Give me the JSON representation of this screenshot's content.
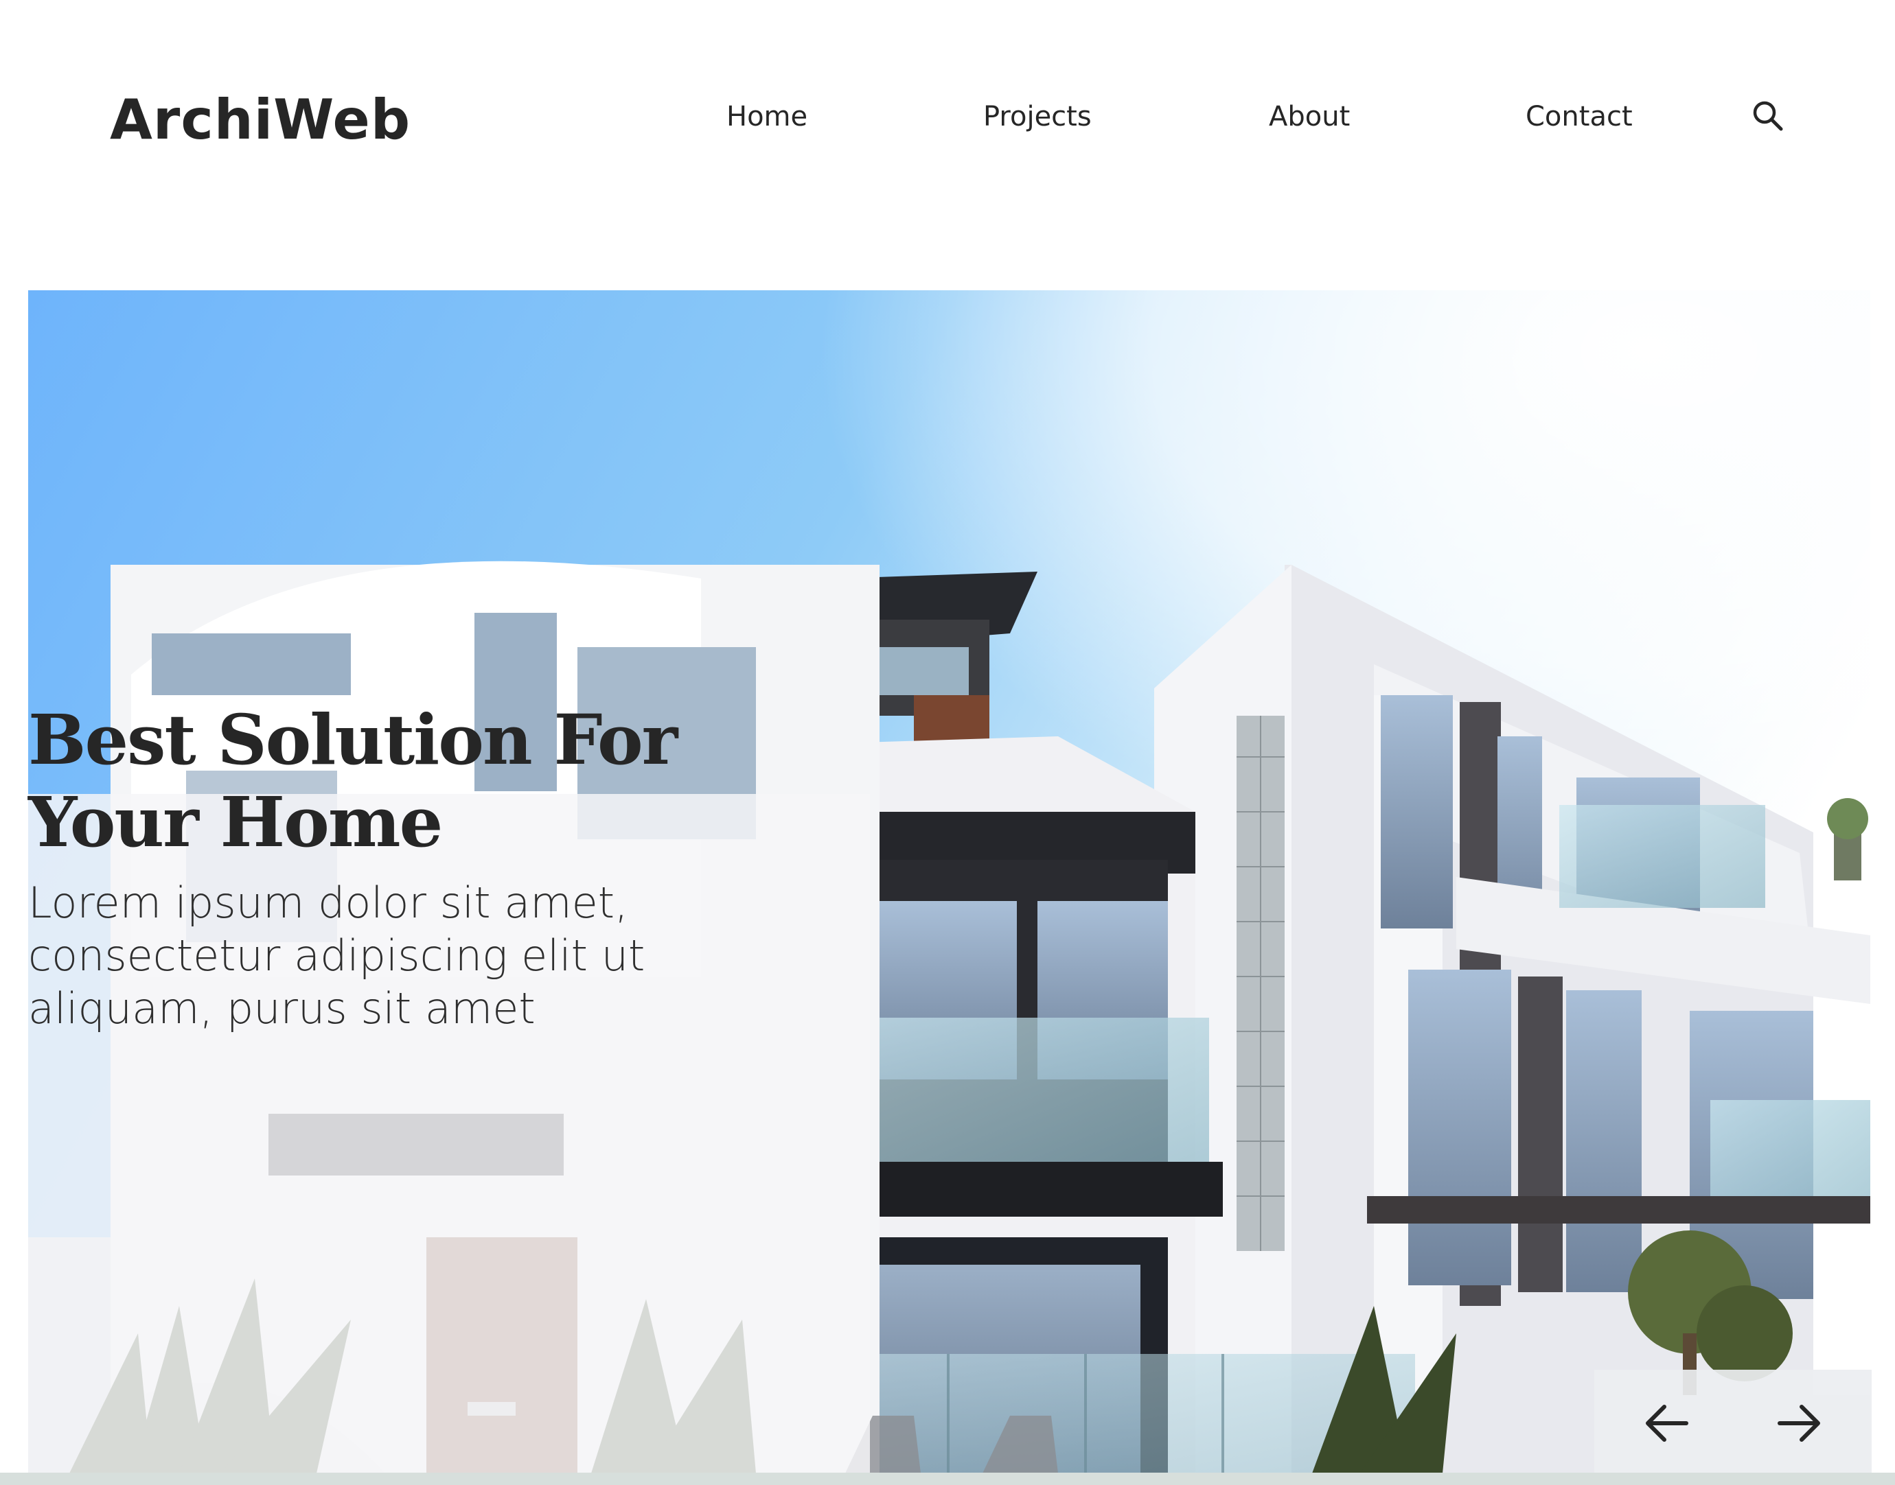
{
  "header": {
    "logo": "ArchiWeb",
    "nav": [
      {
        "label": "Home"
      },
      {
        "label": "Projects"
      },
      {
        "label": "About"
      },
      {
        "label": "Contact"
      }
    ],
    "search_icon": "search-icon"
  },
  "hero": {
    "title": "Best Solution For Your Home",
    "description": "Lorem ipsum dolor sit amet, consectetur adipiscing elit ut aliquam, purus sit amet",
    "image": "modern-house-photo",
    "controls": {
      "prev_icon": "arrow-left-icon",
      "next_icon": "arrow-right-icon"
    }
  },
  "colors": {
    "text": "#262626",
    "sky": "#8ec8f6",
    "overlay": "#f5f6f8",
    "strip": "#d7dfdc"
  }
}
